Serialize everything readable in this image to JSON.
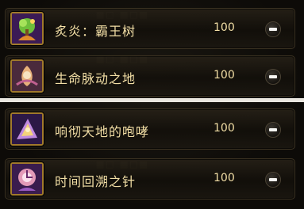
{
  "skills": [
    {
      "name": "炙炎：霸王树",
      "value": "100",
      "icon": "fire-tree-skill-icon"
    },
    {
      "name": "生命脉动之地",
      "value": "100",
      "icon": "life-pulse-skill-icon"
    },
    {
      "name": "响彻天地的咆哮",
      "value": "100",
      "icon": "roar-skill-icon"
    },
    {
      "name": "时间回溯之针",
      "value": "100",
      "icon": "time-needle-skill-icon"
    }
  ],
  "colors": {
    "text": "#f3dfa6",
    "frame": "#a17a2c",
    "divider": "#e9e6df"
  }
}
